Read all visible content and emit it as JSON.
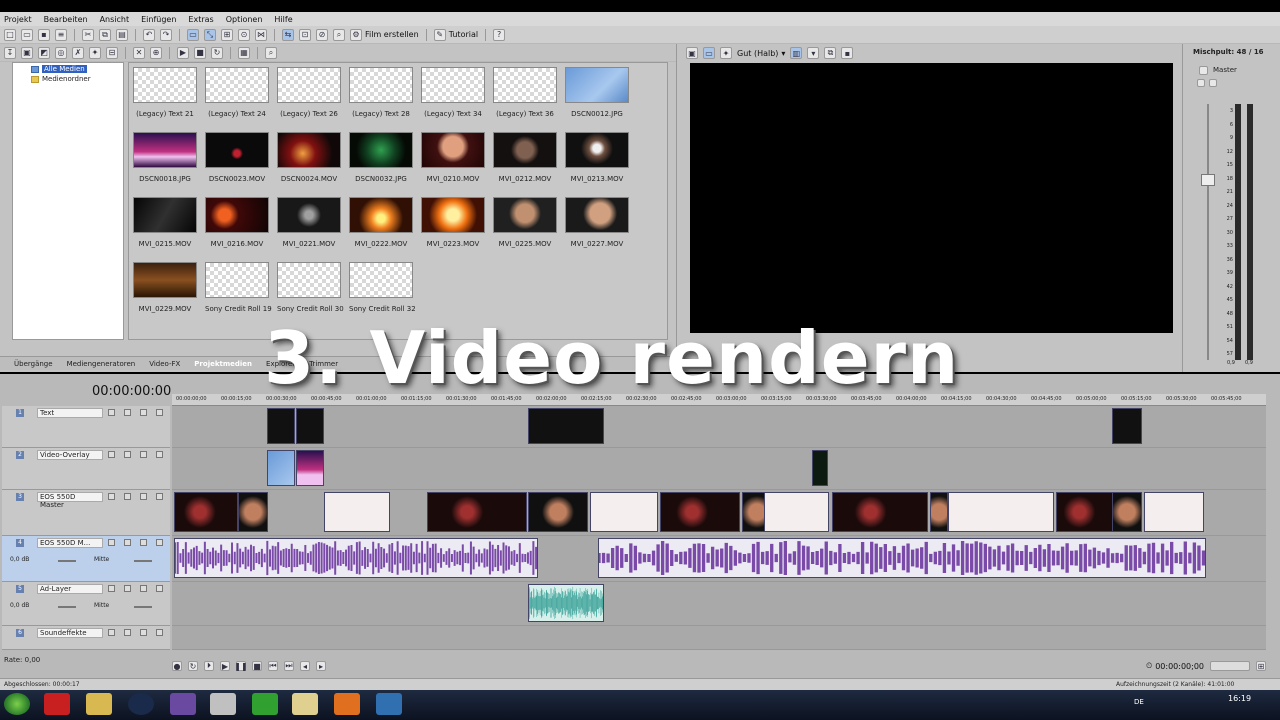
{
  "window_title": "",
  "menu": [
    "Projekt",
    "Bearbeiten",
    "Ansicht",
    "Einfügen",
    "Extras",
    "Optionen",
    "Hilfe"
  ],
  "toolbar": {
    "render_label": "Film erstellen",
    "tutorial_label": "Tutorial"
  },
  "tree": {
    "all_media": "Alle Medien",
    "media_folder": "Medienordner"
  },
  "media": [
    {
      "label": "(Legacy) Text 21",
      "kind": "checker"
    },
    {
      "label": "(Legacy) Text 24",
      "kind": "checker"
    },
    {
      "label": "(Legacy) Text 26",
      "kind": "checker"
    },
    {
      "label": "(Legacy) Text 28",
      "kind": "checker"
    },
    {
      "label": "(Legacy) Text 34",
      "kind": "checker"
    },
    {
      "label": "(Legacy) Text 36",
      "kind": "checker"
    },
    {
      "label": "DSCN0012.JPG",
      "kind": "flowers"
    },
    {
      "label": "DSCN0018.JPG",
      "kind": "gate"
    },
    {
      "label": "DSCN0023.MOV",
      "kind": "dark1"
    },
    {
      "label": "DSCN0024.MOV",
      "kind": "street"
    },
    {
      "label": "DSCN0032.JPG",
      "kind": "building"
    },
    {
      "label": "MVI_0210.MOV",
      "kind": "face"
    },
    {
      "label": "MVI_0212.MOV",
      "kind": "hands"
    },
    {
      "label": "MVI_0213.MOV",
      "kind": "phone"
    },
    {
      "label": "MVI_0215.MOV",
      "kind": "dark2"
    },
    {
      "label": "MVI_0216.MOV",
      "kind": "lights"
    },
    {
      "label": "MVI_0221.MOV",
      "kind": "dark3"
    },
    {
      "label": "MVI_0222.MOV",
      "kind": "fire"
    },
    {
      "label": "MVI_0223.MOV",
      "kind": "fire2"
    },
    {
      "label": "MVI_0225.MOV",
      "kind": "face2"
    },
    {
      "label": "MVI_0227.MOV",
      "kind": "face3"
    },
    {
      "label": "MVI_0229.MOV",
      "kind": "table"
    },
    {
      "label": "Sony Credit Roll 19",
      "kind": "checker"
    },
    {
      "label": "Sony Credit Roll 30",
      "kind": "checker"
    },
    {
      "label": "Sony Credit Roll 32",
      "kind": "checker"
    }
  ],
  "tabs": [
    {
      "label": "Übergänge",
      "active": false
    },
    {
      "label": "Mediengeneratoren",
      "active": false
    },
    {
      "label": "Video-FX",
      "active": false
    },
    {
      "label": "Projektmedien",
      "active": true
    },
    {
      "label": "Explorer",
      "active": false
    },
    {
      "label": "Trimmer",
      "active": false
    }
  ],
  "preview": {
    "quality": "Gut (Halb)"
  },
  "mixer": {
    "title": "Mischpult: 48 / 16",
    "master": "Master",
    "scale": [
      "3",
      "6",
      "9",
      "12",
      "15",
      "18",
      "21",
      "24",
      "27",
      "30",
      "33",
      "36",
      "39",
      "42",
      "45",
      "48",
      "51",
      "54",
      "57"
    ],
    "bottom_left": "0,9",
    "bottom_right": "0,9"
  },
  "timeline": {
    "timecode": "00:00:00:00",
    "ruler": [
      "00:00:00;00",
      "00:00:15;00",
      "00:00:30;00",
      "00:00:45;00",
      "00:01:00;00",
      "00:01:15;00",
      "00:01:30;00",
      "00:01:45;00",
      "00:02:00;00",
      "00:02:15;00",
      "00:02:30;00",
      "00:02:45;00",
      "00:03:00;00",
      "00:03:15;00",
      "00:03:30;00",
      "00:03:45;00",
      "00:04:00;00",
      "00:04:15;00",
      "00:04:30;00",
      "00:04:45;00",
      "00:05:00;00",
      "00:05:15;00",
      "00:05:30;00",
      "00:05:45;00"
    ],
    "tracks": [
      {
        "num": "1",
        "name": "Text",
        "type": "video"
      },
      {
        "num": "2",
        "name": "Video-Overlay",
        "type": "video"
      },
      {
        "num": "3",
        "name": "EOS 550D Master",
        "type": "video"
      },
      {
        "num": "4",
        "name": "EOS 550D M...",
        "type": "audio",
        "vol": "0,0 dB",
        "pan": "Mitte"
      },
      {
        "num": "5",
        "name": "Ad-Layer",
        "type": "audio",
        "vol": "0,0 dB",
        "pan": "Mitte"
      },
      {
        "num": "6",
        "name": "Soundeffekte",
        "type": "audio"
      }
    ]
  },
  "transport": {
    "rate": "Rate: 0,00",
    "end_time": "00:00:00;00"
  },
  "status": {
    "left": "Abgeschlossen: 00:00:17",
    "right": "Aufzeichnungszeit (2 Kanäle): 41:01:00"
  },
  "taskbar": {
    "lang": "DE",
    "clock": "16:19"
  },
  "overlay_caption": "3. Video rendern"
}
